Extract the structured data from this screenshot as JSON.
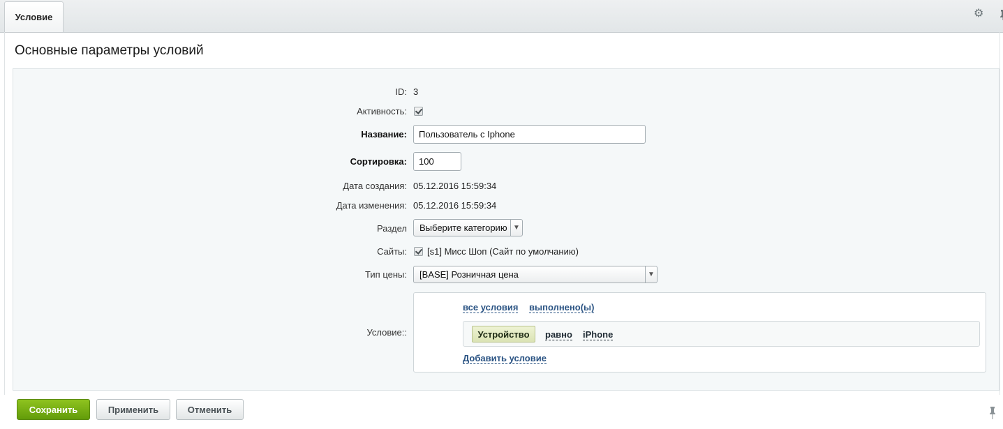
{
  "tabs": [
    {
      "label": "Условие"
    }
  ],
  "page_title": "Основные параметры условий",
  "fields": {
    "id": {
      "label": "ID:",
      "value": "3"
    },
    "active": {
      "label": "Активность:",
      "checked": true
    },
    "name": {
      "label": "Название:",
      "value": "Пользователь с Iphone"
    },
    "sort": {
      "label": "Сортировка:",
      "value": "100"
    },
    "created": {
      "label": "Дата создания:",
      "value": "05.12.2016 15:59:34"
    },
    "modified": {
      "label": "Дата изменения:",
      "value": "05.12.2016 15:59:34"
    },
    "section": {
      "label": "Раздел",
      "value": "Выберите категорию"
    },
    "sites": {
      "label": "Сайты:",
      "value": "[s1] Мисс Шоп (Сайт по умолчанию)",
      "checked": true
    },
    "price_type": {
      "label": "Тип цены:",
      "value": "[BASE] Розничная цена"
    },
    "condition": {
      "label": "Условие::",
      "all_conditions": "все условия",
      "fulfilled": "выполнено(ы)",
      "rule": {
        "field": "Устройство",
        "operator": "равно",
        "value": "iPhone"
      },
      "add_label": "Добавить условие"
    }
  },
  "buttons": {
    "save": "Сохранить",
    "apply": "Применить",
    "cancel": "Отменить"
  },
  "colors": {
    "save_green": "#7db515",
    "link_blue": "#2a5383",
    "panel_bg": "#f5f8f9"
  },
  "icons": {
    "settings": "gear-icon",
    "pin": "pin-icon",
    "dropdown": "chevron-down-icon"
  }
}
